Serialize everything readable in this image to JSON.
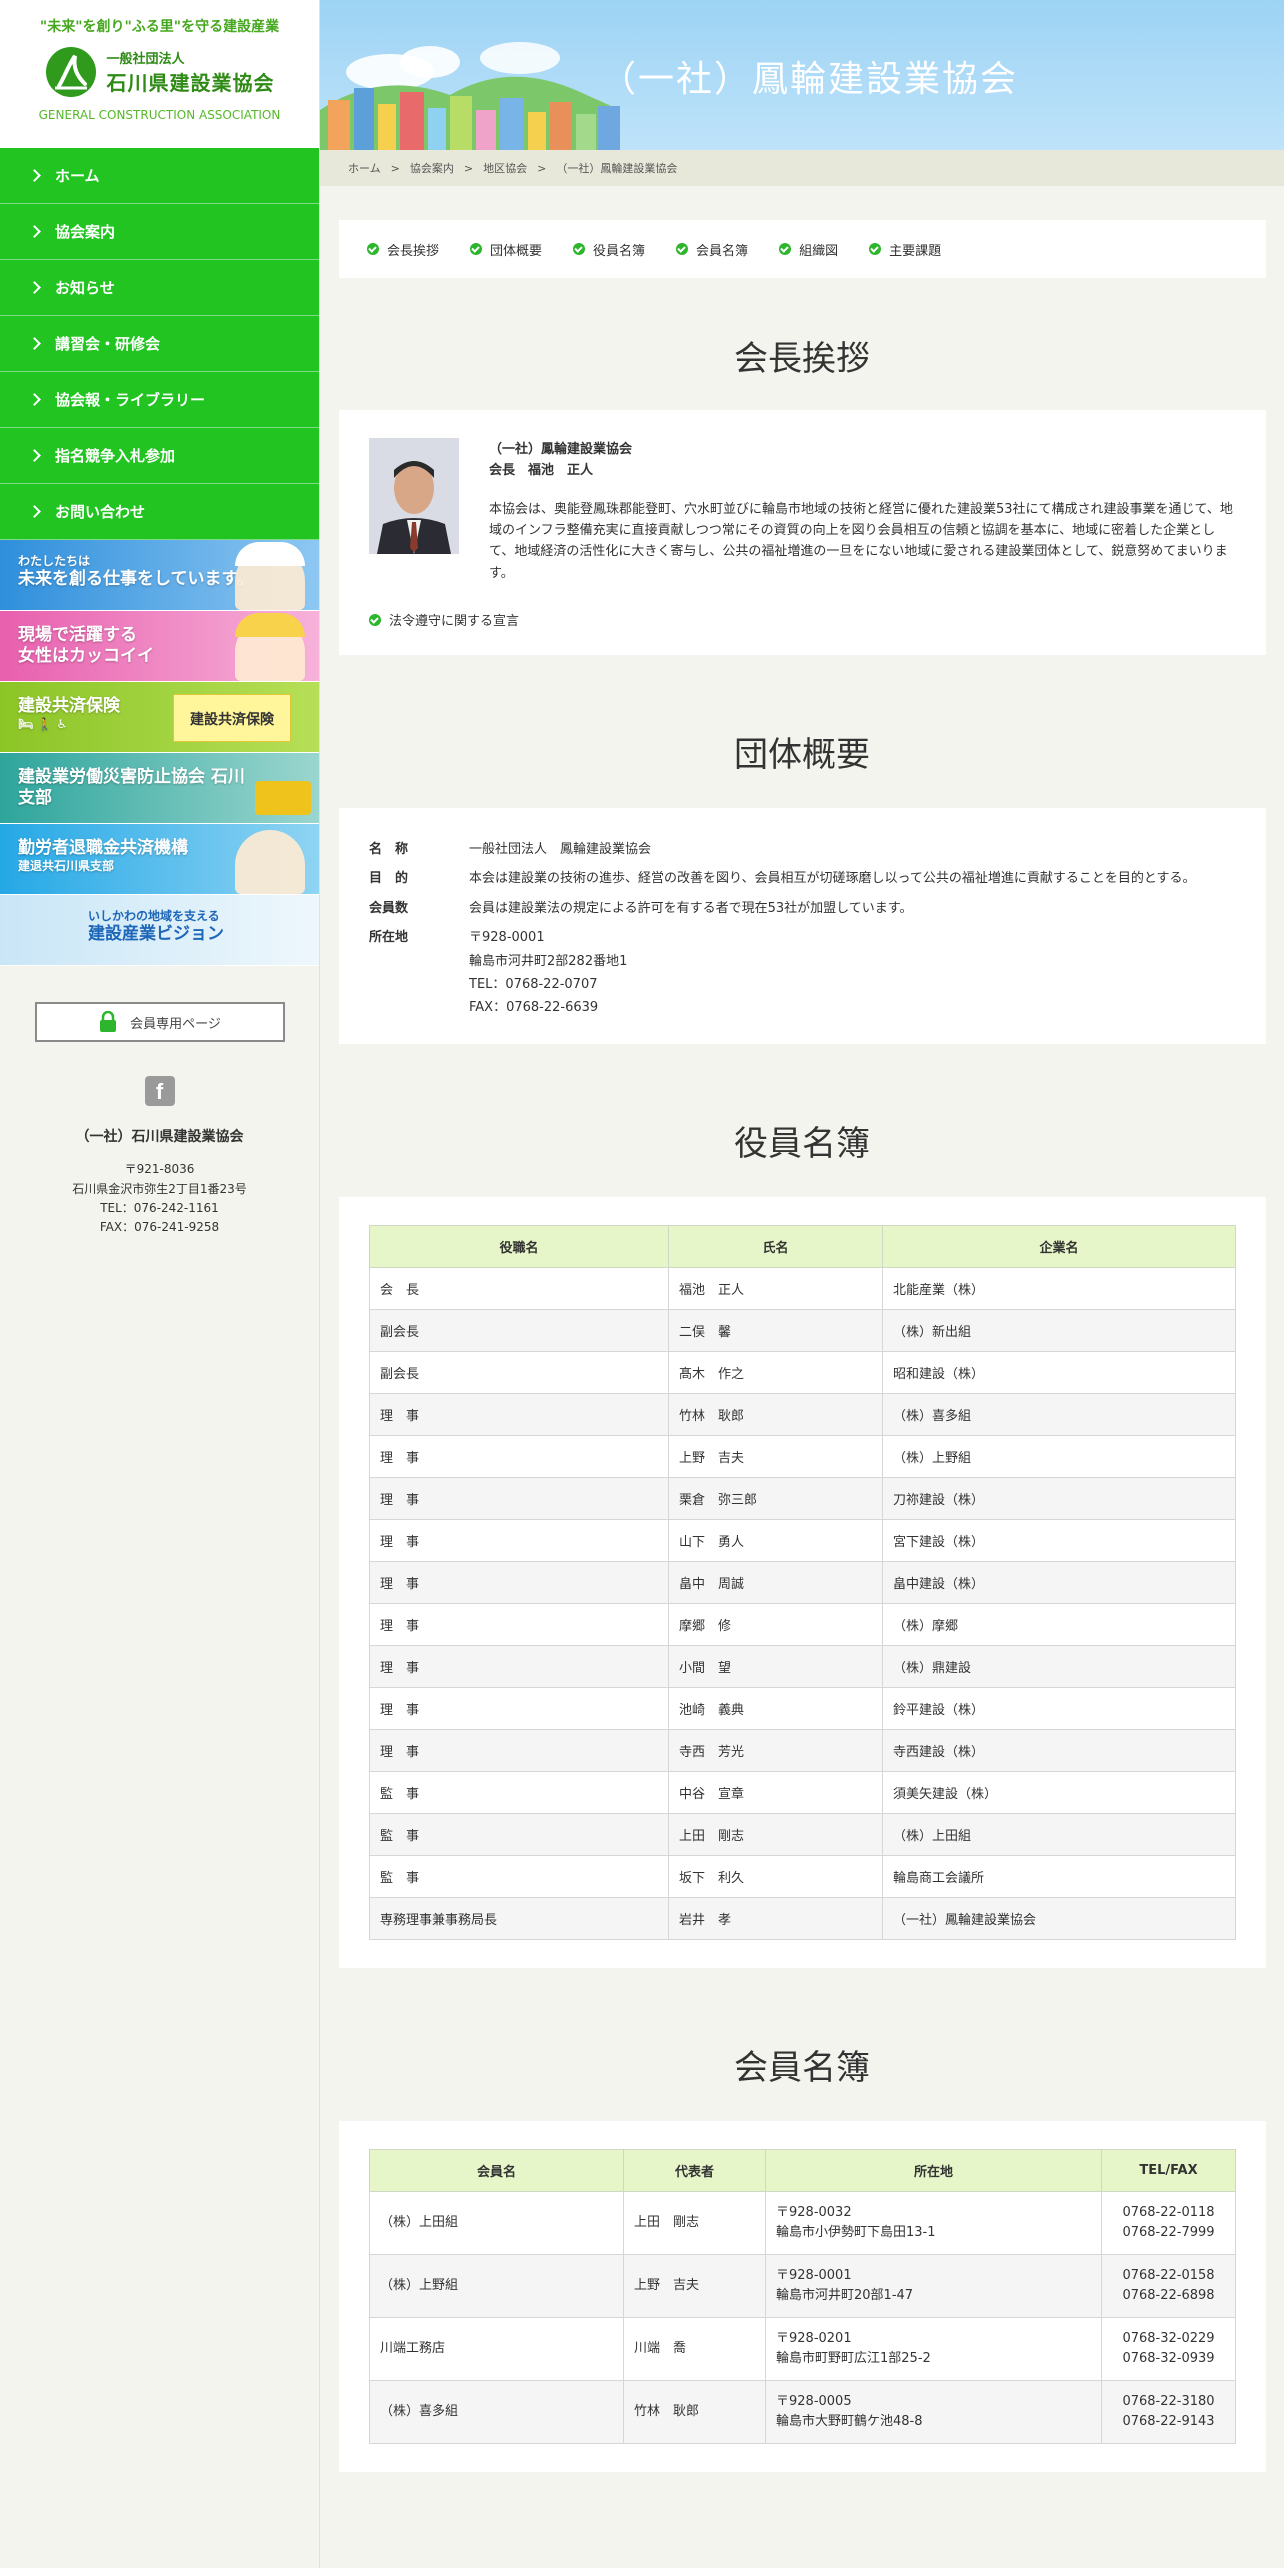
{
  "sidebar": {
    "tagline": "\"未来\"を創り\"ふる里\"を守る建設産業",
    "logo_sub": "一般社団法人",
    "logo_main": "石川県建設業協会",
    "logo_en": "GENERAL CONSTRUCTION ASSOCIATION",
    "nav": [
      "ホーム",
      "協会案内",
      "お知らせ",
      "講習会・研修会",
      "協会報・ライブラリー",
      "指名競争入札参加",
      "お問い合わせ"
    ],
    "banners": [
      {
        "small": "わたしたちは",
        "big": "未来を創る仕事をしています。",
        "color": "#4d9ee0"
      },
      {
        "small": "現場で活躍する",
        "big": "女性はカッコイイ",
        "color": "#ee6fb7"
      },
      {
        "small": "",
        "big": "建設共済保険",
        "badge": "建設共済保険",
        "color": "#93cd2a"
      },
      {
        "small": "",
        "big": "建設業労働災害防止協会 石川支部",
        "color": "#3aa9a3"
      },
      {
        "small": "建退共石川県支部",
        "big": "勤労者退職金共済機構",
        "color": "#3bb7e8"
      },
      {
        "small": "いしかわの地域を支える",
        "big": "建設産業ビジョン",
        "color": "#62b7ea"
      }
    ],
    "member_button": "会員専用ページ",
    "facebook_glyph": "f",
    "address": {
      "org": "（一社）石川県建設業協会",
      "zip": "〒921-8036",
      "street": "石川県金沢市弥生2丁目1番23号",
      "tel": "TEL：076-242-1161",
      "fax": "FAX：076-241-9258"
    }
  },
  "hero": {
    "title": "（一社）鳳輪建設業協会"
  },
  "breadcrumb": [
    "ホーム",
    "協会案内",
    "地区協会",
    "（一社）鳳輪建設業協会"
  ],
  "local_nav": [
    "会長挨拶",
    "団体概要",
    "役員名簿",
    "会員名簿",
    "組織図",
    "主要課題"
  ],
  "greeting": {
    "title": "会長挨拶",
    "org": "（一社）鳳輪建設業協会",
    "role": "会長　福池　正人",
    "body": "本協会は、奥能登鳳珠郡能登町、穴水町並びに輪島市地域の技術と経営に優れた建設業53社にて構成され建設事業を通じて、地域のインフラ整備充実に直接貢献しつつ常にその資質の向上を図り会員相互の信頼と協調を基本に、地域に密着した企業として、地域経済の活性化に大きく寄与し、公共の福祉増進の一旦をにない地域に愛される建設業団体として、鋭意努めてまいります。",
    "link": "法令遵守に関する宣言"
  },
  "overview": {
    "title": "団体概要",
    "rows": [
      {
        "key": "名　称",
        "lines": [
          "一般社団法人　鳳輪建設業協会"
        ]
      },
      {
        "key": "目　的",
        "lines": [
          "本会は建設業の技術の進歩、経営の改善を図り、会員相互が切磋琢磨し以って公共の福祉増進に貢献することを目的とする。"
        ]
      },
      {
        "key": "会員数",
        "lines": [
          "会員は建設業法の規定による許可を有する者で現在53社が加盟しています。"
        ]
      },
      {
        "key": "所在地",
        "lines": [
          "〒928-0001",
          "輪島市河井町2部282番地1",
          "TEL：0768-22-0707",
          "FAX：0768-22-6639"
        ]
      }
    ]
  },
  "officers": {
    "title": "役員名簿",
    "headers": [
      "役職名",
      "氏名",
      "企業名"
    ],
    "rows": [
      [
        "会　長",
        "福池　正人",
        "北能産業（株）"
      ],
      [
        "副会長",
        "二俣　馨",
        "（株）新出組"
      ],
      [
        "副会長",
        "髙木　作之",
        "昭和建設（株）"
      ],
      [
        "理　事",
        "竹林　耿郎",
        "（株）喜多組"
      ],
      [
        "理　事",
        "上野　吉夫",
        "（株）上野組"
      ],
      [
        "理　事",
        "栗倉　弥三郎",
        "刀祢建設（株）"
      ],
      [
        "理　事",
        "山下　勇人",
        "宮下建設（株）"
      ],
      [
        "理　事",
        "畠中　周誠",
        "畠中建設（株）"
      ],
      [
        "理　事",
        "摩郷　修",
        "（株）摩郷"
      ],
      [
        "理　事",
        "小間　望",
        "（株）鼎建設"
      ],
      [
        "理　事",
        "池崎　義典",
        "鈴平建設（株）"
      ],
      [
        "理　事",
        "寺西　芳光",
        "寺西建設（株）"
      ],
      [
        "監　事",
        "中谷　宣章",
        "須美矢建設（株）"
      ],
      [
        "監　事",
        "上田　剛志",
        "（株）上田組"
      ],
      [
        "監　事",
        "坂下　利久",
        "輪島商工会議所"
      ],
      [
        "専務理事兼事務局長",
        "岩井　孝",
        "（一社）鳳輪建設業協会"
      ]
    ]
  },
  "members": {
    "title": "会員名簿",
    "headers": [
      "会員名",
      "代表者",
      "所在地",
      "TEL/FAX"
    ],
    "rows": [
      {
        "name": "（株）上田組",
        "rep": "上田　剛志",
        "zip": "〒928-0032",
        "addr": "輪島市小伊勢町下島田13-1",
        "tel": "0768-22-0118",
        "fax": "0768-22-7999"
      },
      {
        "name": "（株）上野組",
        "rep": "上野　吉夫",
        "zip": "〒928-0001",
        "addr": "輪島市河井町20部1-47",
        "tel": "0768-22-0158",
        "fax": "0768-22-6898"
      },
      {
        "name": "川端工務店",
        "rep": "川端　喬",
        "zip": "〒928-0201",
        "addr": "輪島市町野町広江1部25-2",
        "tel": "0768-32-0229",
        "fax": "0768-32-0939"
      },
      {
        "name": "（株）喜多組",
        "rep": "竹林　耿郎",
        "zip": "〒928-0005",
        "addr": "輪島市大野町鶴ケ池48-8",
        "tel": "0768-22-3180",
        "fax": "0768-22-9143"
      }
    ]
  }
}
